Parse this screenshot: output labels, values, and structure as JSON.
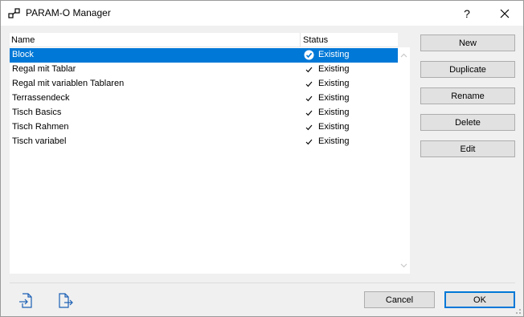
{
  "window": {
    "title": "PARAM-O Manager",
    "help_label": "?",
    "close_label": "✕"
  },
  "list": {
    "columns": {
      "name": "Name",
      "status": "Status"
    },
    "rows": [
      {
        "name": "Block",
        "status": "Existing",
        "selected": true
      },
      {
        "name": "Regal mit Tablar",
        "status": "Existing"
      },
      {
        "name": "Regal mit variablen Tablaren",
        "status": "Existing"
      },
      {
        "name": "Terrassendeck",
        "status": "Existing"
      },
      {
        "name": "Tisch Basics",
        "status": "Existing"
      },
      {
        "name": "Tisch Rahmen",
        "status": "Existing"
      },
      {
        "name": "Tisch variabel",
        "status": "Existing"
      }
    ]
  },
  "actions": {
    "new": "New",
    "duplicate": "Duplicate",
    "rename": "Rename",
    "delete": "Delete",
    "edit": "Edit"
  },
  "footer": {
    "cancel": "Cancel",
    "ok": "OK",
    "import_icon": "import-file-icon",
    "export_icon": "export-file-icon"
  },
  "colors": {
    "selection": "#0078d7",
    "button_bg": "#e1e1e1",
    "button_border": "#adadad",
    "default_button_border": "#0078d7"
  }
}
